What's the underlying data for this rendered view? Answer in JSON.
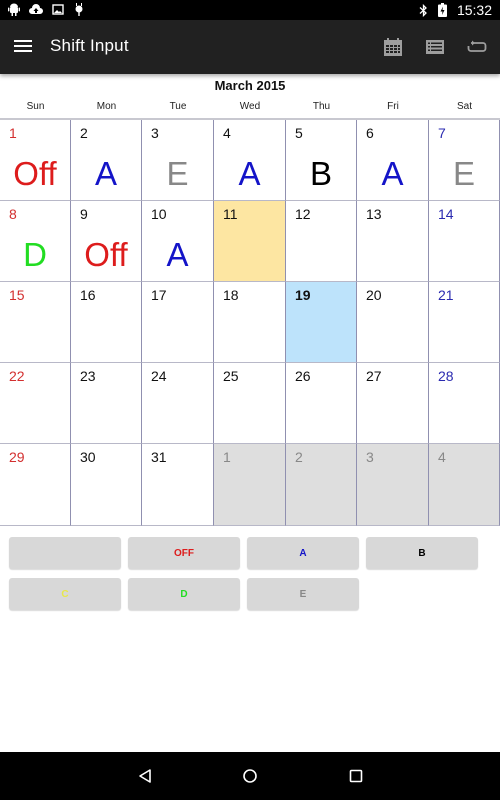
{
  "status_bar": {
    "left_icons": [
      "android-icon",
      "cloud-upload-icon",
      "image-icon",
      "android-debug-icon"
    ],
    "right_icons": [
      "bluetooth-icon",
      "battery-charging-icon"
    ],
    "time": "15:32"
  },
  "app_bar": {
    "title": "Shift Input",
    "menu_icon": "hamburger-menu-icon",
    "actions": [
      {
        "name": "calendar-view",
        "icon": "calendar-icon"
      },
      {
        "name": "list-view",
        "icon": "list-icon"
      },
      {
        "name": "repeat",
        "icon": "repeat-icon"
      }
    ]
  },
  "calendar": {
    "month_title": "March 2015",
    "weekdays": [
      {
        "label": "Sun",
        "color": "#d32f2f"
      },
      {
        "label": "Mon",
        "color": "#222222"
      },
      {
        "label": "Tue",
        "color": "#222222"
      },
      {
        "label": "Wed",
        "color": "#222222"
      },
      {
        "label": "Thu",
        "color": "#222222"
      },
      {
        "label": "Fri",
        "color": "#222222"
      },
      {
        "label": "Sat",
        "color": "#3535b0"
      }
    ],
    "colors": {
      "sunday": "#d32f2f",
      "saturday": "#2a2ab0",
      "weekday": "#111111",
      "other_month": "#888888",
      "selected_bg": "#fde6a2",
      "today_bg": "#bde3fb",
      "other_month_bg": "#dedede"
    },
    "days": [
      {
        "day": "1",
        "shift": "Off",
        "shift_color": "#dd1c1c"
      },
      {
        "day": "2",
        "shift": "A",
        "shift_color": "#1414c8"
      },
      {
        "day": "3",
        "shift": "E",
        "shift_color": "#888888"
      },
      {
        "day": "4",
        "shift": "A",
        "shift_color": "#1414c8"
      },
      {
        "day": "5",
        "shift": "B",
        "shift_color": "#000000"
      },
      {
        "day": "6",
        "shift": "A",
        "shift_color": "#1414c8"
      },
      {
        "day": "7",
        "shift": "E",
        "shift_color": "#888888"
      },
      {
        "day": "8",
        "shift": "D",
        "shift_color": "#22dd22"
      },
      {
        "day": "9",
        "shift": "Off",
        "shift_color": "#dd1c1c"
      },
      {
        "day": "10",
        "shift": "A",
        "shift_color": "#1414c8"
      },
      {
        "day": "11",
        "shift": "",
        "state": "selected"
      },
      {
        "day": "12",
        "shift": ""
      },
      {
        "day": "13",
        "shift": ""
      },
      {
        "day": "14",
        "shift": ""
      },
      {
        "day": "15",
        "shift": ""
      },
      {
        "day": "16",
        "shift": ""
      },
      {
        "day": "17",
        "shift": ""
      },
      {
        "day": "18",
        "shift": ""
      },
      {
        "day": "19",
        "shift": "",
        "state": "today"
      },
      {
        "day": "20",
        "shift": ""
      },
      {
        "day": "21",
        "shift": ""
      },
      {
        "day": "22",
        "shift": ""
      },
      {
        "day": "23",
        "shift": ""
      },
      {
        "day": "24",
        "shift": ""
      },
      {
        "day": "25",
        "shift": ""
      },
      {
        "day": "26",
        "shift": ""
      },
      {
        "day": "27",
        "shift": ""
      },
      {
        "day": "28",
        "shift": ""
      },
      {
        "day": "29",
        "shift": ""
      },
      {
        "day": "30",
        "shift": ""
      },
      {
        "day": "31",
        "shift": ""
      },
      {
        "day": "1",
        "shift": "",
        "state": "other-month"
      },
      {
        "day": "2",
        "shift": "",
        "state": "other-month"
      },
      {
        "day": "3",
        "shift": "",
        "state": "other-month"
      },
      {
        "day": "4",
        "shift": "",
        "state": "other-month"
      }
    ]
  },
  "shift_buttons": [
    {
      "label": "",
      "color": "#000000",
      "name": "shift-button-clear"
    },
    {
      "label": "OFF",
      "color": "#dd1c1c",
      "name": "shift-button-off"
    },
    {
      "label": "A",
      "color": "#1414c8",
      "name": "shift-button-a"
    },
    {
      "label": "B",
      "color": "#000000",
      "name": "shift-button-b"
    },
    {
      "label": "C",
      "color": "#e8e84a",
      "name": "shift-button-c"
    },
    {
      "label": "D",
      "color": "#22dd22",
      "name": "shift-button-d"
    },
    {
      "label": "E",
      "color": "#888888",
      "name": "shift-button-e"
    }
  ],
  "nav_bar": {
    "buttons": [
      "back",
      "home",
      "recents"
    ]
  }
}
